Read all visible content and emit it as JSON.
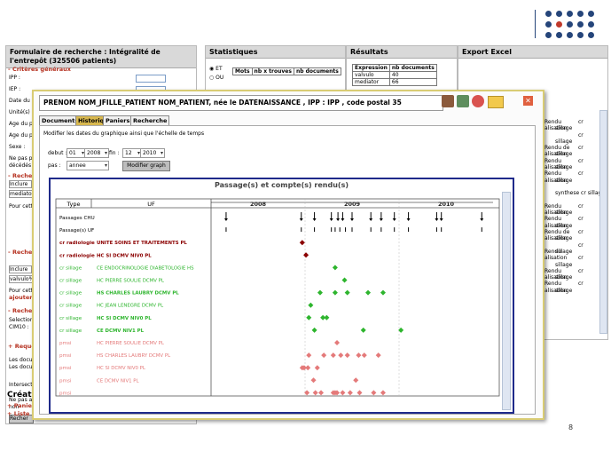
{
  "page_number": "8",
  "colors": {
    "brand_blue": "#25457a",
    "brand_red": "#c0392b",
    "modal_border": "#d9cc74",
    "chart_border": "#1f2a8a",
    "radiologie": "#8b0000",
    "sillage": "#2eb52e",
    "pmsi": "#e47a7a"
  },
  "search_panel": {
    "title": "Formulaire de recherche : Intégralité de l'entrepôt (325506 patients)",
    "section_criteria": "- Critères généraux",
    "labels": [
      "IPP :",
      "IEP :",
      "Date du",
      "Unité(s)",
      "Age du p",
      "Age du p",
      "Sexe :",
      "Ne pas p",
      "décédés"
    ],
    "section_recherche1": "- Recher",
    "select1": "Inclure",
    "input1": "mediator c",
    "pour_cette": "Pour cette",
    "section_recherche2": "- Recher",
    "select2": "Inclure",
    "input2": "valvulo%",
    "pour_cette2": "Pour cette",
    "ajouter": "ajouter",
    "section_recherche3": "- Reche",
    "lines3": [
      "Selection",
      "CIM10 :"
    ],
    "requete": "+ Requê",
    "lines4": [
      "Les docu",
      "Les docu"
    ],
    "intersect": "Intersecti",
    "lines5": [
      "Ne pas af",
      "non"
    ],
    "rech_button": "Recher",
    "creation": "Créati",
    "panier": "+ Panier",
    "liste": "+ Liste c"
  },
  "stats_panel": {
    "title": "Statistiques",
    "radio_et": "ET",
    "radio_ou": "OU",
    "headers": [
      "Mots",
      "nb x trouves",
      "nb documents"
    ]
  },
  "results_panel": {
    "title": "Résultats",
    "headers": [
      "Expression",
      "nb documents"
    ],
    "rows": [
      [
        "valvulo",
        "40"
      ],
      [
        "mediator",
        "66"
      ]
    ]
  },
  "export_panel": {
    "title": "Export Excel",
    "rows": [
      [
        "Rendu",
        "cr"
      ],
      [
        "alisation",
        "sillage"
      ],
      [
        "",
        "cr"
      ],
      [
        "",
        "sillage"
      ],
      [
        "Rendu de",
        "cr"
      ],
      [
        "alisation",
        "sillage"
      ],
      [
        "Rendu",
        "cr"
      ],
      [
        "alisation",
        "sillage"
      ],
      [
        "Rendu",
        "cr"
      ],
      [
        "alisation",
        "sillage"
      ],
      [
        "",
        ""
      ],
      [
        "",
        "synthese cr sillage"
      ],
      [
        "",
        ""
      ],
      [
        "Rendu",
        "cr"
      ],
      [
        "alisation",
        "sillage"
      ],
      [
        "Rendu",
        "cr"
      ],
      [
        "alisation",
        "sillage"
      ],
      [
        "Rendu de",
        "cr"
      ],
      [
        "alisation",
        "sillage"
      ],
      [
        "",
        "cr"
      ],
      [
        "Rendu",
        "sillage"
      ],
      [
        "alisation",
        "cr"
      ],
      [
        "",
        "sillage"
      ],
      [
        "Rendu",
        "cr"
      ],
      [
        "alisation",
        "sillage"
      ],
      [
        "Rendu",
        "cr"
      ],
      [
        "alisation",
        "sillage"
      ]
    ]
  },
  "modal": {
    "patient_header": "PRENOM NOM_JFILLE_PATIENT NOM_PATIENT, née le DATENAISSANCE , IPP : IPP , code postal 35",
    "tabs": [
      "Documents",
      "Historique",
      "Paniers",
      "Recherche"
    ],
    "instructions": "Modifier les dates du graphique ainsi que l'échelle de temps",
    "debut_label": "debut :",
    "debut_day": "01",
    "debut_year": "2008",
    "fin_label": "fin :",
    "fin_month": "12",
    "fin_year": "2010",
    "pas_label": "pas :",
    "pas_value": "annee",
    "modify_button": "Modifier graph"
  },
  "chart_data": {
    "type": "timeline",
    "title": "Passage(s) et compte(s) rendu(s)",
    "col_type": "Type",
    "col_uf": "UF",
    "years": [
      "2008",
      "2009",
      "2010"
    ],
    "x_range": [
      2008.0,
      2011.0
    ],
    "rows": [
      {
        "type": "Passages CHU",
        "uf": "",
        "kind": "passage",
        "color": "#000000",
        "x": [
          2008.16,
          2008.96,
          2009.1,
          2009.28,
          2009.35,
          2009.4,
          2009.5,
          2009.7,
          2009.81,
          2009.95,
          2010.1,
          2010.4,
          2010.45,
          2010.88
        ]
      },
      {
        "type": "Passage(s) UF",
        "uf": "",
        "kind": "tick",
        "color": "#000000",
        "x": [
          2008.16,
          2008.96,
          2009.1,
          2009.28,
          2009.32,
          2009.37,
          2009.43,
          2009.5,
          2009.7,
          2009.81,
          2009.95,
          2010.1,
          2010.4,
          2010.45,
          2010.88
        ]
      },
      {
        "type": "cr radiologie",
        "uf": "UNITE SOINS ET TRAITEMENTS PL",
        "kind": "diamond",
        "color": "#8b0000",
        "x": [
          2008.97
        ]
      },
      {
        "type": "cr radiologie",
        "uf": "HC SI DCMV NIV0 PL",
        "kind": "diamond",
        "color": "#8b0000",
        "x": [
          2009.01
        ]
      },
      {
        "type": "cr sillage",
        "uf": "CE ENDOCRINOLOGIE DIABETOLOGIE HS",
        "kind": "diamond",
        "color": "#2eb52e",
        "x": [
          2009.32
        ]
      },
      {
        "type": "cr sillage",
        "uf": "HC PIERRE SOULIE DCMV PL",
        "kind": "diamond",
        "color": "#2eb52e",
        "x": [
          2009.42
        ]
      },
      {
        "type": "cr sillage",
        "uf": "HS CHARLES LAUBRY DCMV PL",
        "kind": "diamond",
        "color": "#2eb52e",
        "x": [
          2009.16,
          2009.32,
          2009.45,
          2009.67,
          2009.83
        ]
      },
      {
        "type": "cr sillage",
        "uf": "HC JEAN LENEGRE DCMV PL",
        "kind": "diamond",
        "color": "#2eb52e",
        "x": [
          2009.06
        ]
      },
      {
        "type": "cr sillage",
        "uf": "HC SI DCMV NIV0 PL",
        "kind": "diamond",
        "color": "#2eb52e",
        "x": [
          2009.04,
          2009.19,
          2009.23
        ]
      },
      {
        "type": "cr sillage",
        "uf": "CE DCMV NIV1 PL",
        "kind": "diamond",
        "color": "#2eb52e",
        "x": [
          2009.1,
          2009.62,
          2010.02
        ]
      },
      {
        "type": "pmsi",
        "uf": "HC PIERRE SOULIE DCMV PL",
        "kind": "diamond",
        "color": "#e47a7a",
        "x": [
          2009.34
        ]
      },
      {
        "type": "pmsi",
        "uf": "HS CHARLES LAUBRY DCMV PL",
        "kind": "diamond",
        "color": "#e47a7a",
        "x": [
          2009.04,
          2009.2,
          2009.3,
          2009.38,
          2009.45,
          2009.57,
          2009.63,
          2009.78
        ]
      },
      {
        "type": "pmsi",
        "uf": "HC SI DCMV NIV0 PL",
        "kind": "diamond",
        "color": "#e47a7a",
        "x": [
          2008.97,
          2008.99,
          2009.03,
          2009.13
        ]
      },
      {
        "type": "pmsi",
        "uf": "CE DCMV NIV1 PL",
        "kind": "diamond",
        "color": "#e47a7a",
        "x": [
          2009.09,
          2009.54
        ]
      },
      {
        "type": "pmsi",
        "uf": "",
        "kind": "diamond",
        "color": "#e47a7a",
        "x": [
          2009.02,
          2009.11,
          2009.17,
          2009.3,
          2009.32,
          2009.34,
          2009.4,
          2009.48,
          2009.58,
          2009.73,
          2009.83
        ]
      }
    ]
  }
}
